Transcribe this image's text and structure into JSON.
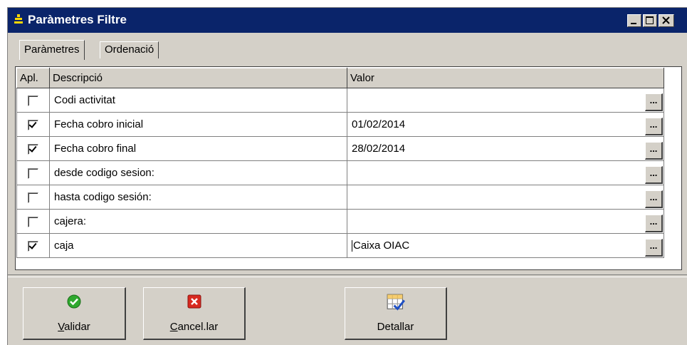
{
  "window": {
    "title": "Paràmetres Filtre",
    "controls": [
      "minimize",
      "maximize",
      "close"
    ]
  },
  "tabs": [
    {
      "label": "Paràmetres",
      "active": true
    },
    {
      "label": "Ordenació",
      "active": false
    }
  ],
  "grid": {
    "columns": [
      "Apl.",
      "Descripció",
      "Valor"
    ],
    "rows": [
      {
        "checked": false,
        "description": "Codi activitat",
        "value": ""
      },
      {
        "checked": true,
        "description": "Fecha cobro inicial",
        "value": "01/02/2014"
      },
      {
        "checked": true,
        "description": "Fecha cobro final",
        "value": "28/02/2014"
      },
      {
        "checked": false,
        "description": "desde codigo sesion:",
        "value": ""
      },
      {
        "checked": false,
        "description": "hasta codigo sesión:",
        "value": ""
      },
      {
        "checked": false,
        "description": "cajera:",
        "value": ""
      },
      {
        "checked": true,
        "description": "caja",
        "value": "Caixa OIAC"
      }
    ],
    "ellipsis_label": "..."
  },
  "buttons": {
    "validar": {
      "mnemonic": "V",
      "rest": "alidar",
      "icon": "green-check-icon"
    },
    "cancelar": {
      "mnemonic": "C",
      "rest": "ancel.lar",
      "icon": "red-x-icon"
    },
    "detallar": {
      "label": "Detallar",
      "icon": "grid-check-icon"
    }
  },
  "colors": {
    "titlebar": "#0a246a",
    "face": "#d4d0c8"
  }
}
